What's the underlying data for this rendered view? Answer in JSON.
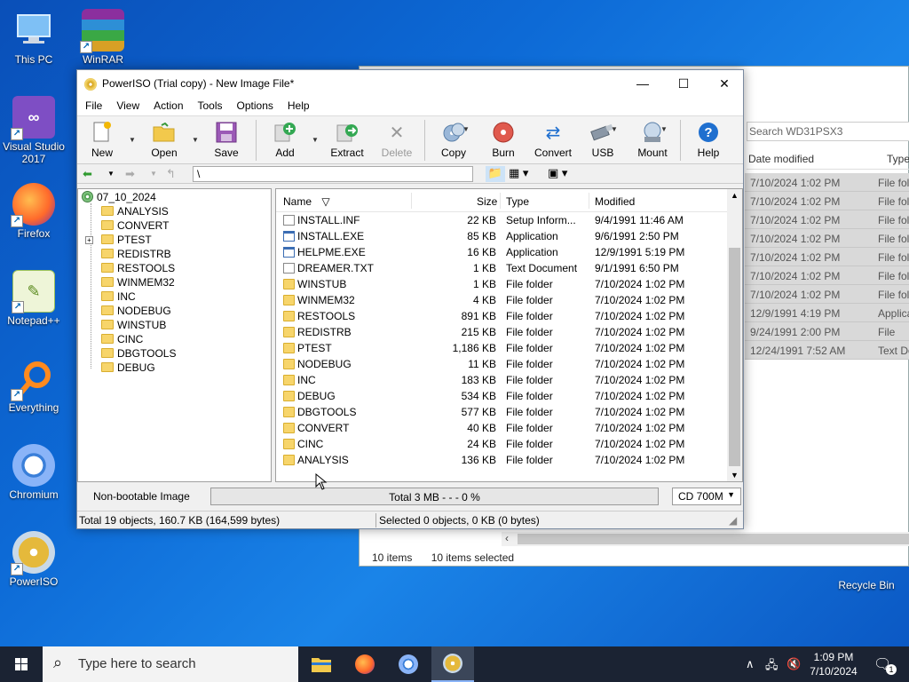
{
  "desktop": {
    "icons": [
      {
        "label": "This PC",
        "icon": "computer-icon"
      },
      {
        "label": "WinRAR",
        "icon": "winrar-icon"
      },
      {
        "label": "Visual Studio 2017",
        "icon": "visual-studio-icon"
      },
      {
        "label": "Firefox",
        "icon": "firefox-icon"
      },
      {
        "label": "Notepad++",
        "icon": "notepad-plus-icon"
      },
      {
        "label": "Everything",
        "icon": "everything-icon"
      },
      {
        "label": "Chromium",
        "icon": "chromium-icon"
      },
      {
        "label": "PowerISO",
        "icon": "poweriso-icon"
      },
      {
        "label": "Recycle Bin",
        "icon": "recycle-bin-icon"
      }
    ]
  },
  "explorer": {
    "search_placeholder": "Search WD31PSX3",
    "columns": [
      "Date modified",
      "Type"
    ],
    "rows": [
      {
        "date": "7/10/2024 1:02 PM",
        "type": "File fold"
      },
      {
        "date": "7/10/2024 1:02 PM",
        "type": "File fold"
      },
      {
        "date": "7/10/2024 1:02 PM",
        "type": "File fold"
      },
      {
        "date": "7/10/2024 1:02 PM",
        "type": "File fold"
      },
      {
        "date": "7/10/2024 1:02 PM",
        "type": "File fold"
      },
      {
        "date": "7/10/2024 1:02 PM",
        "type": "File fold"
      },
      {
        "date": "7/10/2024 1:02 PM",
        "type": "File fold"
      },
      {
        "date": "12/9/1991 4:19 PM",
        "type": "Applica"
      },
      {
        "date": "9/24/1991 2:00 PM",
        "type": "File"
      },
      {
        "date": "12/24/1991 7:52 AM",
        "type": "Text Do"
      }
    ],
    "status_items": "10 items",
    "status_selected": "10 items selected"
  },
  "poweriso": {
    "title": "PowerISO (Trial copy) - New Image File*",
    "menu": [
      "File",
      "View",
      "Action",
      "Tools",
      "Options",
      "Help"
    ],
    "toolbar": {
      "new": "New",
      "open": "Open",
      "save": "Save",
      "add": "Add",
      "extract": "Extract",
      "delete": "Delete",
      "copy": "Copy",
      "burn": "Burn",
      "convert": "Convert",
      "usb": "USB",
      "mount": "Mount",
      "help": "Help"
    },
    "path": "\\",
    "tree": {
      "root": "07_10_2024",
      "folders": [
        "ANALYSIS",
        "CONVERT",
        "PTEST",
        "REDISTRB",
        "RESTOOLS",
        "WINMEM32",
        "INC",
        "NODEBUG",
        "WINSTUB",
        "CINC",
        "DBGTOOLS",
        "DEBUG"
      ]
    },
    "columns": {
      "name": "Name",
      "size": "Size",
      "type": "Type",
      "modified": "Modified"
    },
    "files": [
      {
        "name": "INSTALL.INF",
        "size": "22 KB",
        "type": "Setup Inform...",
        "modified": "9/4/1991 11:46 AM",
        "kind": "file"
      },
      {
        "name": "INSTALL.EXE",
        "size": "85 KB",
        "type": "Application",
        "modified": "9/6/1991 2:50 PM",
        "kind": "app"
      },
      {
        "name": "HELPME.EXE",
        "size": "16 KB",
        "type": "Application",
        "modified": "12/9/1991 5:19 PM",
        "kind": "app"
      },
      {
        "name": "DREAMER.TXT",
        "size": "1 KB",
        "type": "Text Document",
        "modified": "9/1/1991 6:50 PM",
        "kind": "file"
      },
      {
        "name": "WINSTUB",
        "size": "1 KB",
        "type": "File folder",
        "modified": "7/10/2024 1:02 PM",
        "kind": "folder"
      },
      {
        "name": "WINMEM32",
        "size": "4 KB",
        "type": "File folder",
        "modified": "7/10/2024 1:02 PM",
        "kind": "folder"
      },
      {
        "name": "RESTOOLS",
        "size": "891 KB",
        "type": "File folder",
        "modified": "7/10/2024 1:02 PM",
        "kind": "folder"
      },
      {
        "name": "REDISTRB",
        "size": "215 KB",
        "type": "File folder",
        "modified": "7/10/2024 1:02 PM",
        "kind": "folder"
      },
      {
        "name": "PTEST",
        "size": "1,186 KB",
        "type": "File folder",
        "modified": "7/10/2024 1:02 PM",
        "kind": "folder"
      },
      {
        "name": "NODEBUG",
        "size": "11 KB",
        "type": "File folder",
        "modified": "7/10/2024 1:02 PM",
        "kind": "folder"
      },
      {
        "name": "INC",
        "size": "183 KB",
        "type": "File folder",
        "modified": "7/10/2024 1:02 PM",
        "kind": "folder"
      },
      {
        "name": "DEBUG",
        "size": "534 KB",
        "type": "File folder",
        "modified": "7/10/2024 1:02 PM",
        "kind": "folder"
      },
      {
        "name": "DBGTOOLS",
        "size": "577 KB",
        "type": "File folder",
        "modified": "7/10/2024 1:02 PM",
        "kind": "folder"
      },
      {
        "name": "CONVERT",
        "size": "40 KB",
        "type": "File folder",
        "modified": "7/10/2024 1:02 PM",
        "kind": "folder"
      },
      {
        "name": "CINC",
        "size": "24 KB",
        "type": "File folder",
        "modified": "7/10/2024 1:02 PM",
        "kind": "folder"
      },
      {
        "name": "ANALYSIS",
        "size": "136 KB",
        "type": "File folder",
        "modified": "7/10/2024 1:02 PM",
        "kind": "folder"
      }
    ],
    "bootable": "Non-bootable Image",
    "usage": "Total  3 MB   - - -  0 %",
    "media": "CD 700M",
    "status_total": "Total 19 objects, 160.7 KB (164,599 bytes)",
    "status_selected": "Selected 0 objects, 0 KB (0 bytes)"
  },
  "taskbar": {
    "search_placeholder": "Type here to search",
    "time": "1:09 PM",
    "date": "7/10/2024",
    "notification_count": "1"
  },
  "colors": {
    "desktop_accent": "#0d6ad6",
    "taskbar": "#1b2333",
    "folder": "#f7d56b"
  }
}
